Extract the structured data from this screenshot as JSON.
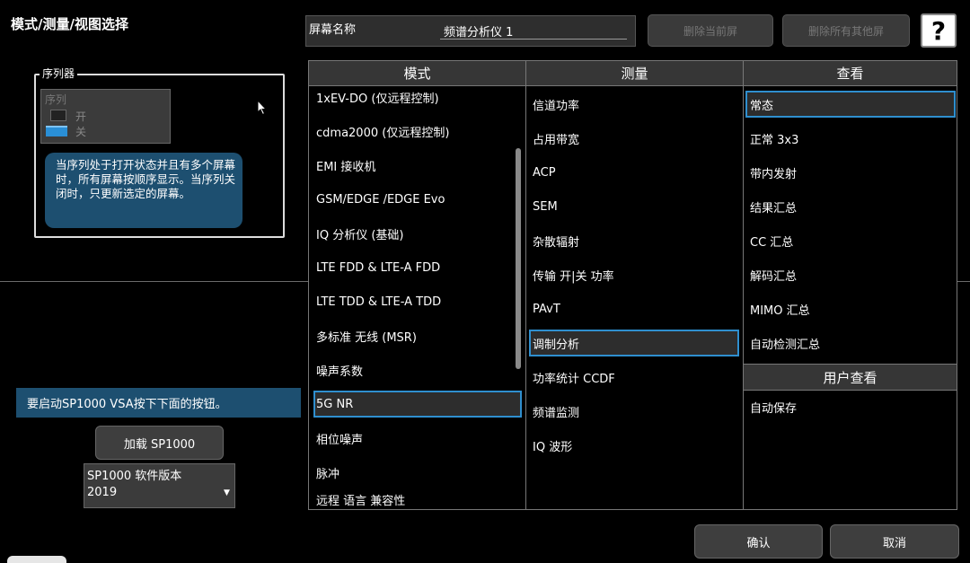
{
  "window": {
    "title": "模式/测量/视图选择"
  },
  "screen": {
    "label": "屏幕名称",
    "name": "频谱分析仪 1"
  },
  "top_buttons": {
    "delete_current": "删除当前屏",
    "delete_others": "删除所有其他屏",
    "help": "?"
  },
  "sequencer": {
    "legend": "序列器",
    "toggle_label": "序列",
    "on": "开",
    "off": "关",
    "description": "当序列处于打开状态并且有多个屏幕时，所有屏幕按顺序显示。当序列关闭时，只更新选定的屏幕。"
  },
  "sp1000": {
    "banner": "要启动SP1000 VSA按下下面的按钮。",
    "load_button": "加载 SP1000",
    "version_label": "SP1000 软件版本",
    "version_value": "2019"
  },
  "columns": {
    "mode": "模式",
    "measurement": "测量",
    "view": "查看",
    "user_view": "用户查看"
  },
  "modes": [
    "1xEV-DO (仅远程控制)",
    "cdma2000 (仅远程控制)",
    "EMI 接收机",
    "GSM/EDGE /EDGE Evo",
    "IQ 分析仪 (基础)",
    "LTE FDD & LTE-A FDD",
    "LTE TDD & LTE-A TDD",
    "多标准 无线 (MSR)",
    "噪声系数",
    "5G NR",
    "相位噪声",
    "脉冲",
    "远程 语言 兼容性"
  ],
  "selected_mode": "5G NR",
  "measurements": [
    "信道功率",
    "占用带宽",
    "ACP",
    "SEM",
    "杂散辐射",
    "传输 开|关 功率",
    "PAvT",
    "调制分析",
    "功率统计 CCDF",
    "频谱监测",
    "IQ 波形"
  ],
  "selected_measurement": "调制分析",
  "views": [
    "常态",
    "正常 3x3",
    "带内发射",
    "结果汇总",
    "CC 汇总",
    "解码汇总",
    "MIMO 汇总",
    "自动检测汇总"
  ],
  "selected_view": "常态",
  "user_views": [
    "自动保存"
  ],
  "bottom_buttons": {
    "ok": "确认",
    "cancel": "取消"
  }
}
